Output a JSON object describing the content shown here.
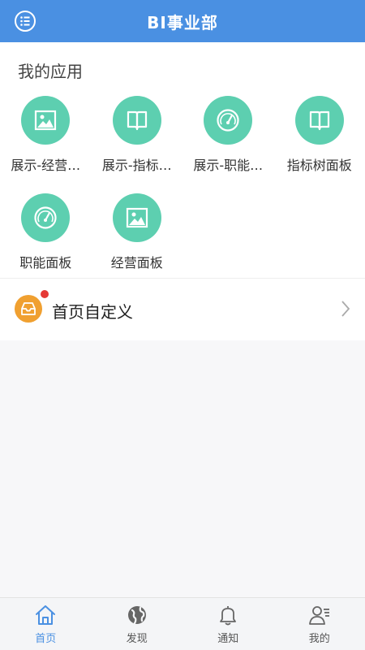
{
  "header": {
    "title": "BI事业部"
  },
  "apps": {
    "section_title": "我的应用",
    "items": [
      {
        "label": "展示-经营…",
        "icon": "image-icon"
      },
      {
        "label": "展示-指标…",
        "icon": "book-icon"
      },
      {
        "label": "展示-职能…",
        "icon": "gauge-icon"
      },
      {
        "label": "指标树面板",
        "icon": "book-icon"
      },
      {
        "label": "职能面板",
        "icon": "gauge-icon"
      },
      {
        "label": "经营面板",
        "icon": "image-icon"
      }
    ]
  },
  "custom": {
    "label": "首页自定义"
  },
  "tabs": [
    {
      "label": "首页",
      "icon": "home-icon",
      "active": true
    },
    {
      "label": "发现",
      "icon": "globe-icon",
      "active": false
    },
    {
      "label": "通知",
      "icon": "bell-icon",
      "active": false
    },
    {
      "label": "我的",
      "icon": "user-icon",
      "active": false
    }
  ],
  "colors": {
    "header_bg": "#4a90e2",
    "app_icon_bg": "#5dcfb0",
    "custom_icon_bg": "#f0a030",
    "badge": "#e53935",
    "tab_active": "#4a90e2"
  }
}
